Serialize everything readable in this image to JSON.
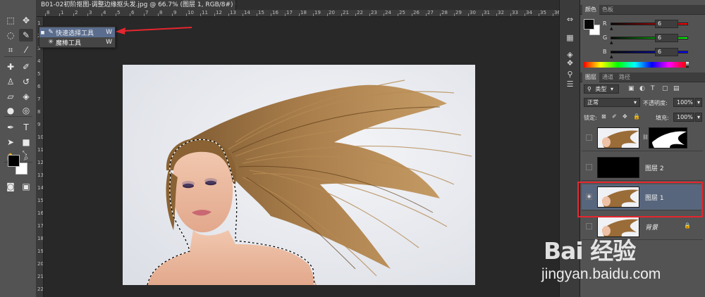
{
  "document": {
    "tab_title": "B01-02初阶抠图-调整边缘抠头发.jpg @ 66.7% (图层 1, RGB/8#) *",
    "close_glyph": "×"
  },
  "rulers": {
    "top": [
      "8",
      "1",
      "2",
      "3",
      "4",
      "5",
      "6",
      "7",
      "8",
      "9",
      "10",
      "11",
      "12",
      "13",
      "14",
      "15",
      "16",
      "17",
      "18",
      "19",
      "20",
      "21",
      "22",
      "23",
      "24",
      "25",
      "26",
      "27",
      "28",
      "29",
      "30",
      "31",
      "32",
      "33",
      "34",
      "35",
      "36"
    ],
    "left": [
      "1",
      "2",
      "3",
      "4",
      "5",
      "6",
      "7",
      "8",
      "9",
      "10",
      "11",
      "12",
      "13",
      "14",
      "15",
      "16",
      "17",
      "18",
      "19",
      "20",
      "21",
      "22"
    ]
  },
  "toolbar": {
    "tools": [
      {
        "name": "marquee-tool-icon",
        "glyph": "⬚"
      },
      {
        "name": "move-tool-icon",
        "glyph": "✥"
      },
      {
        "name": "lasso-tool-icon",
        "glyph": "◌"
      },
      {
        "name": "quick-selection-tool-icon",
        "glyph": "✎"
      },
      {
        "name": "crop-tool-icon",
        "glyph": "⌗"
      },
      {
        "name": "eyedropper-tool-icon",
        "glyph": "⁄"
      },
      {
        "name": "healing-brush-tool-icon",
        "glyph": "✚"
      },
      {
        "name": "brush-tool-icon",
        "glyph": "✐"
      },
      {
        "name": "clone-stamp-tool-icon",
        "glyph": "♙"
      },
      {
        "name": "history-brush-tool-icon",
        "glyph": "↺"
      },
      {
        "name": "eraser-tool-icon",
        "glyph": "▱"
      },
      {
        "name": "paint-bucket-tool-icon",
        "glyph": "◈"
      },
      {
        "name": "blur-tool-icon",
        "glyph": "●"
      },
      {
        "name": "dodge-tool-icon",
        "glyph": "◎"
      },
      {
        "name": "pen-tool-icon",
        "glyph": "✒"
      },
      {
        "name": "type-tool-icon",
        "glyph": "T"
      },
      {
        "name": "path-selection-tool-icon",
        "glyph": "➤"
      },
      {
        "name": "shape-tool-icon",
        "glyph": "■"
      },
      {
        "name": "hand-tool-icon",
        "glyph": "✋"
      },
      {
        "name": "zoom-tool-icon",
        "glyph": "⌕"
      }
    ],
    "foreground_color": "#000000",
    "background_color": "#ffffff",
    "swap_glyph": "⤡",
    "quick_mask_glyph": "◙",
    "screen_mode_glyph": "▣"
  },
  "flyout": {
    "items": [
      {
        "label": "快速选择工具",
        "shortcut": "W",
        "selected": true,
        "bullet": "■",
        "icon": "✎"
      },
      {
        "label": "魔棒工具",
        "shortcut": "W",
        "selected": false,
        "bullet": "",
        "icon": "✳"
      }
    ]
  },
  "side_icons": [
    "⇔",
    "▦",
    "◈",
    "❖",
    "⚲",
    "☰"
  ],
  "color_panel": {
    "tabs": [
      {
        "label": "颜色",
        "active": true
      },
      {
        "label": "色板",
        "active": false
      }
    ],
    "foreground": "#060606",
    "background": "#ffffff",
    "sliders": [
      {
        "label": "R",
        "value": "6",
        "gradient": "linear-gradient(to right,#060606,#ff0606)"
      },
      {
        "label": "G",
        "value": "6",
        "gradient": "linear-gradient(to right,#060606,#06ff06)"
      },
      {
        "label": "B",
        "value": "6",
        "gradient": "linear-gradient(to right,#060606,#0606ff)"
      }
    ]
  },
  "layers_panel": {
    "tabs": [
      {
        "label": "图层",
        "active": true
      },
      {
        "label": "通道",
        "active": false
      },
      {
        "label": "路径",
        "active": false
      }
    ],
    "filter_label": "类型",
    "filter_glyph": "⚲",
    "filter_icons": [
      "▣",
      "◐",
      "T",
      "▢",
      "▤"
    ],
    "blend_mode": "正常",
    "opacity_label": "不透明度:",
    "opacity_value": "100%",
    "lock_label": "锁定:",
    "lock_icons": [
      "⊠",
      "✐",
      "✥",
      "🔒"
    ],
    "fill_label": "填充:",
    "fill_value": "100%",
    "arrow": "▾",
    "layers": [
      {
        "name": "",
        "visible": false,
        "selected": false,
        "thumb": "hair",
        "has_mask": true
      },
      {
        "name": "图层 2",
        "visible": false,
        "selected": false,
        "thumb": "black",
        "has_mask": false
      },
      {
        "name": "图层 1",
        "visible": true,
        "selected": true,
        "thumb": "hair",
        "has_mask": false
      },
      {
        "name": "背景",
        "visible": false,
        "selected": false,
        "thumb": "hair",
        "has_mask": false,
        "locked": true
      }
    ],
    "eye_glyph": "◉",
    "lock_glyph": "🔒",
    "link_glyph": "⛓"
  },
  "colors": {
    "annotation_red": "#e5262e",
    "selection_blue": "#5a6d8e"
  },
  "watermark": {
    "brand": "Bai 经验",
    "url": "jingyan.baidu.com"
  }
}
